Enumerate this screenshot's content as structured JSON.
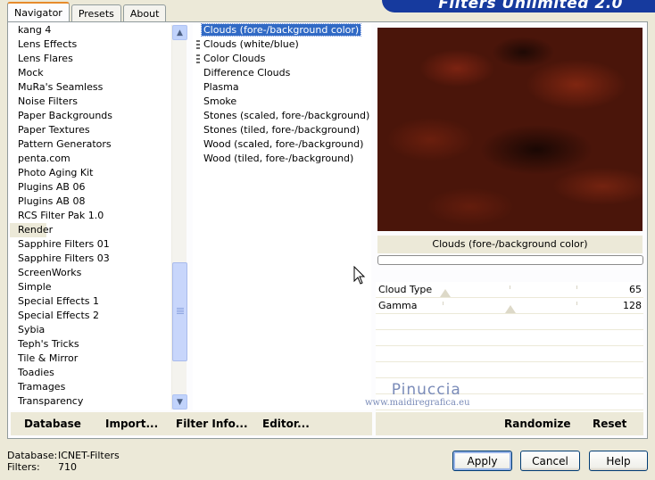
{
  "tabs": [
    {
      "label": "Navigator",
      "active": true
    },
    {
      "label": "Presets"
    },
    {
      "label": "About"
    }
  ],
  "banner_title": "Filters Unlimited 2.0",
  "categories": {
    "items": [
      "kang 4",
      "Lens Effects",
      "Lens Flares",
      "Mock",
      "MuRa's Seamless",
      "Noise Filters",
      "Paper Backgrounds",
      "Paper Textures",
      "Pattern Generators",
      "penta.com",
      "Photo Aging Kit",
      "Plugins AB 06",
      "Plugins AB 08",
      "RCS Filter Pak 1.0",
      "Render",
      "Sapphire Filters 01",
      "Sapphire Filters 03",
      "ScreenWorks",
      "Simple",
      "Special Effects 1",
      "Special Effects 2",
      "Sybia",
      "Teph's Tricks",
      "Tile & Mirror",
      "Toadies",
      "Tramages",
      "Transparency"
    ],
    "selected": "Render"
  },
  "filters": {
    "items": [
      "Clouds (fore-/background color)",
      "Clouds (white/blue)",
      "Color Clouds",
      "Difference Clouds",
      "Plasma",
      "Smoke",
      "Stones (scaled, fore-/background)",
      "Stones (tiled, fore-/background)",
      "Wood (scaled, fore-/background)",
      "Wood (tiled, fore-/background)"
    ],
    "selected": "Clouds (fore-/background color)"
  },
  "preview": {
    "filter_name": "Clouds (fore-/background color)"
  },
  "params": [
    {
      "label": "Cloud Type",
      "value": "65"
    },
    {
      "label": "Gamma",
      "value": "128"
    }
  ],
  "watermark": {
    "line1": "Pinuccia",
    "line2": "www.maidiregrafica.eu"
  },
  "toolbar": {
    "database": "Database",
    "import": "Import...",
    "filter_info": "Filter Info...",
    "editor": "Editor...",
    "randomize": "Randomize",
    "reset": "Reset"
  },
  "info": {
    "database_label": "Database:",
    "database_value": "ICNET-Filters",
    "filters_label": "Filters:",
    "filters_value": "710"
  },
  "buttons": {
    "apply": "Apply",
    "cancel": "Cancel",
    "help": "Help"
  },
  "colors": {
    "selection": "#316ac5",
    "banner": "#163a9e",
    "background": "#ece9d8"
  }
}
